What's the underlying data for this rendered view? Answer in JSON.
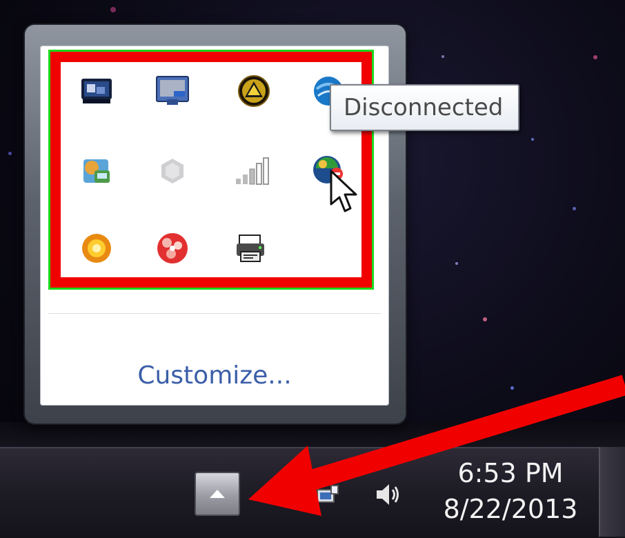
{
  "tray_flyout": {
    "icons": [
      {
        "name": "dell-dock-icon"
      },
      {
        "name": "monitor-display-icon"
      },
      {
        "name": "warning-triangle-icon"
      },
      {
        "name": "globe-network-icon"
      },
      {
        "name": "update-tool-icon"
      },
      {
        "name": "gray-hex-icon"
      },
      {
        "name": "signal-strength-icon"
      },
      {
        "name": "network-disconnected-icon"
      },
      {
        "name": "orange-sun-icon"
      },
      {
        "name": "red-flower-icon"
      },
      {
        "name": "printer-icon"
      }
    ],
    "customize_label": "Customize..."
  },
  "tooltip": {
    "text": "Disconnected"
  },
  "taskbar": {
    "show_hidden_icon": "chevron-up-icon",
    "tray_icons": [
      "network-icon",
      "speaker-icon"
    ]
  },
  "clock": {
    "time": "6:53 PM",
    "date": "8/22/2013"
  },
  "annotation": {
    "box_color": "#f10000",
    "arrow_color": "#f10000"
  }
}
